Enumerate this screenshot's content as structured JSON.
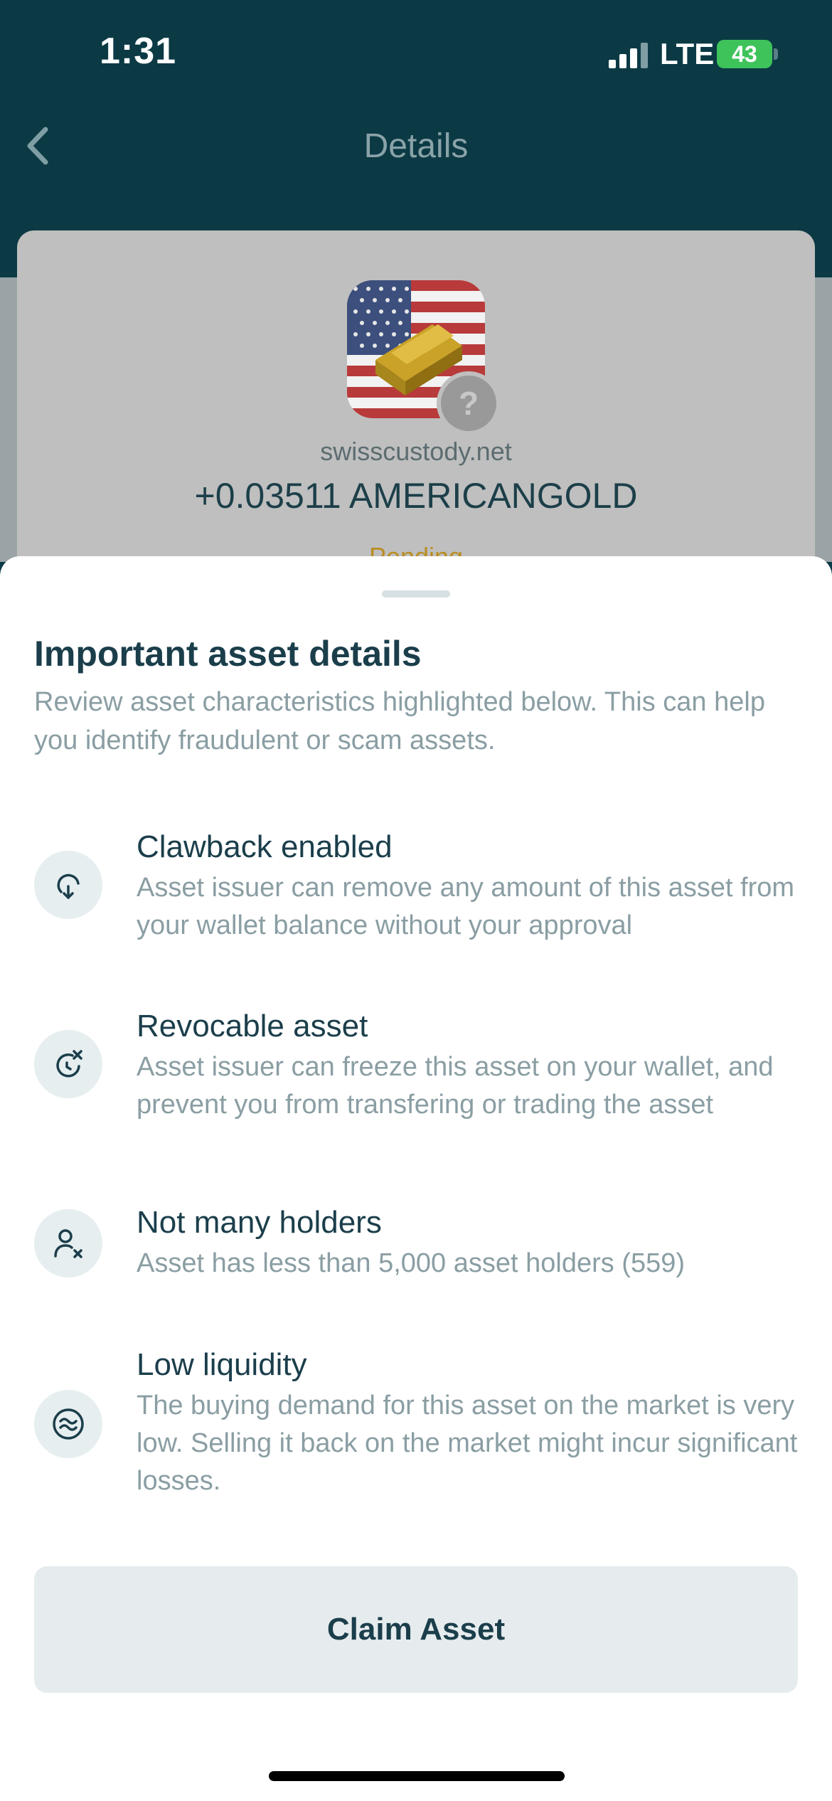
{
  "status_bar": {
    "time": "1:31",
    "network": "LTE",
    "battery": "43"
  },
  "header": {
    "title": "Details",
    "back_icon": "chevron-left-icon"
  },
  "asset": {
    "domain": "swisscustody.net",
    "amount": "+0.03511 AMERICANGOLD",
    "status": "Pending",
    "help_badge": "?"
  },
  "sheet": {
    "title": "Important asset details",
    "subtitle": "Review asset characteristics highlighted below. This can help you identify fraudulent or scam assets.",
    "items": [
      {
        "icon": "clawback-icon",
        "title": "Clawback enabled",
        "description": "Asset issuer can remove any amount of this asset from your wallet balance without your approval"
      },
      {
        "icon": "revocable-icon",
        "title": "Revocable asset",
        "description": "Asset issuer can freeze this asset on your wallet, and prevent you from transfering or trading the asset"
      },
      {
        "icon": "user-x-icon",
        "title": "Not many holders",
        "description": "Asset has less than 5,000 asset holders (559)"
      },
      {
        "icon": "liquidity-icon",
        "title": "Low liquidity",
        "description": "The buying demand for this asset on the market is very low. Selling it back on the market might incur significant losses."
      }
    ],
    "claim_label": "Claim Asset"
  },
  "colors": {
    "header_bg": "#0b3a45",
    "text_dark": "#1b3e4b",
    "text_muted": "#8a9ea3",
    "pending": "#b98d23",
    "battery": "#3ec35b"
  }
}
